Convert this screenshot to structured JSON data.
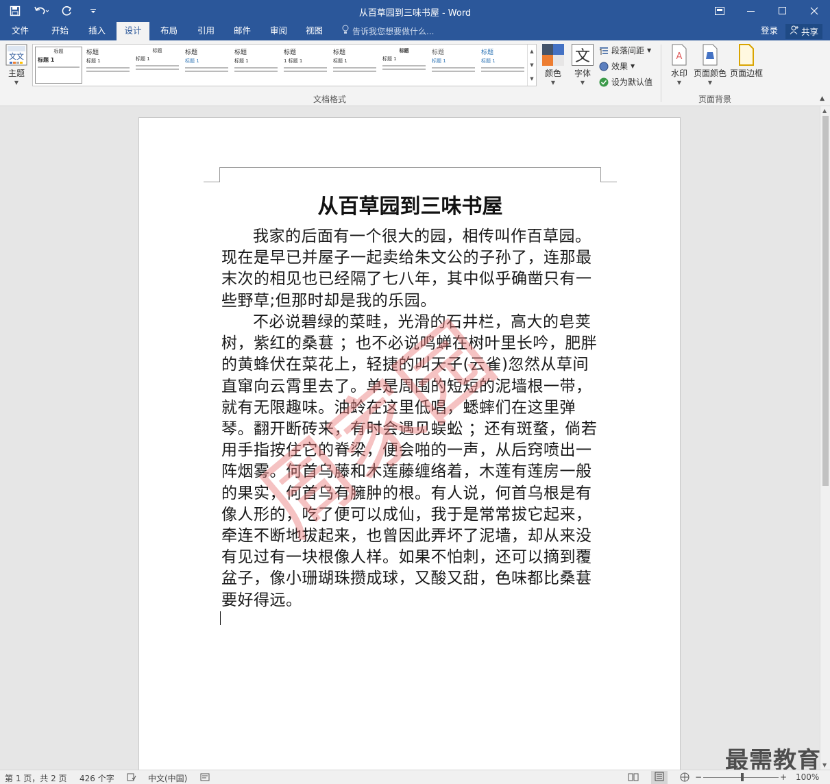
{
  "window": {
    "title": "从百草园到三味书屋 - Word",
    "controls": [
      "restore-ribbon",
      "minimize",
      "maximize",
      "close"
    ]
  },
  "tabs": [
    {
      "label": "文件"
    },
    {
      "label": "开始"
    },
    {
      "label": "插入"
    },
    {
      "label": "设计"
    },
    {
      "label": "布局"
    },
    {
      "label": "引用"
    },
    {
      "label": "邮件"
    },
    {
      "label": "审阅"
    },
    {
      "label": "视图"
    }
  ],
  "tellme": {
    "placeholder": "告诉我您想要做什么..."
  },
  "account": {
    "signin": "登录",
    "share": "共享"
  },
  "ribbon": {
    "theme_label": "主题",
    "gallery": [
      {
        "title": "标题",
        "heading": "标题 1"
      },
      {
        "title": "标题",
        "heading": "标题 1"
      },
      {
        "title": "标题",
        "heading": "标题 1"
      },
      {
        "title": "标题",
        "heading": "标题 1"
      },
      {
        "title": "标题",
        "heading": "标题 1"
      },
      {
        "title": "标题",
        "heading": "1 标题 1"
      },
      {
        "title": "标题",
        "heading": "标题 1"
      },
      {
        "title": "标题",
        "heading": "标题 1"
      },
      {
        "title": "标题",
        "heading": "标题 1"
      },
      {
        "title": "标题",
        "heading": "标题 1"
      }
    ],
    "colors_label": "颜色",
    "fonts_label": "字体",
    "fonts_glyph": "文",
    "paragraph_spacing": "段落间距",
    "effects": "效果",
    "set_default": "设为默认值",
    "group_doc_format": "文档格式",
    "watermark": "水印",
    "page_color": "页面颜色",
    "page_borders": "页面边框",
    "group_page_background": "页面背景"
  },
  "document": {
    "title": "从百草园到三味书屋",
    "paragraphs": [
      "我家的后面有一个很大的园，相传叫作百草园。现在是早已并屋子一起卖给朱文公的子孙了，连那最末次的相见也已经隔了七八年，其中似乎确凿只有一些野草;但那时却是我的乐园。",
      "不必说碧绿的菜畦，光滑的石井栏，高大的皂荚树，紫红的桑葚 ；也不必说鸣蝉在树叶里长吟，肥胖的黄蜂伏在菜花上，轻捷的叫天子(云雀)忽然从草间直窜向云霄里去了。单是周围的短短的泥墙根一带，就有无限趣味。油蛉在这里低唱，蟋蟀们在这里弹琴。翻开断砖来，有时会遇见蜈蚣 ；还有斑蝥，倘若用手指按住它的脊梁，便会啪的一声，从后窍喷出一阵烟雾。何首乌藤和木莲藤缠络着，木莲有莲房一般的果实，何首乌有臃肿的根。有人说，何首乌根是有像人形的，吃了便可以成仙，我于是常常拔它起来，牵连不断地拔起来，也曾因此弄坏了泥墙，却从来没有见过有一块根像人样。如果不怕刺，还可以摘到覆盆子，像小珊瑚珠攒成球，又酸又甜，色味都比桑葚要好得远。"
    ],
    "watermark_text": "周家园"
  },
  "brand_watermark": "最需教育",
  "status": {
    "page": "第 1 页，共 2 页",
    "words": "426 个字",
    "language": "中文(中国)",
    "zoom": "100%",
    "zoom_level": 1.0
  },
  "colors": {
    "title_bar": "#2b579a",
    "ribbon_bg": "#f3f3f3",
    "doc_bg": "#e6e6e6",
    "watermark": "#e87878"
  }
}
